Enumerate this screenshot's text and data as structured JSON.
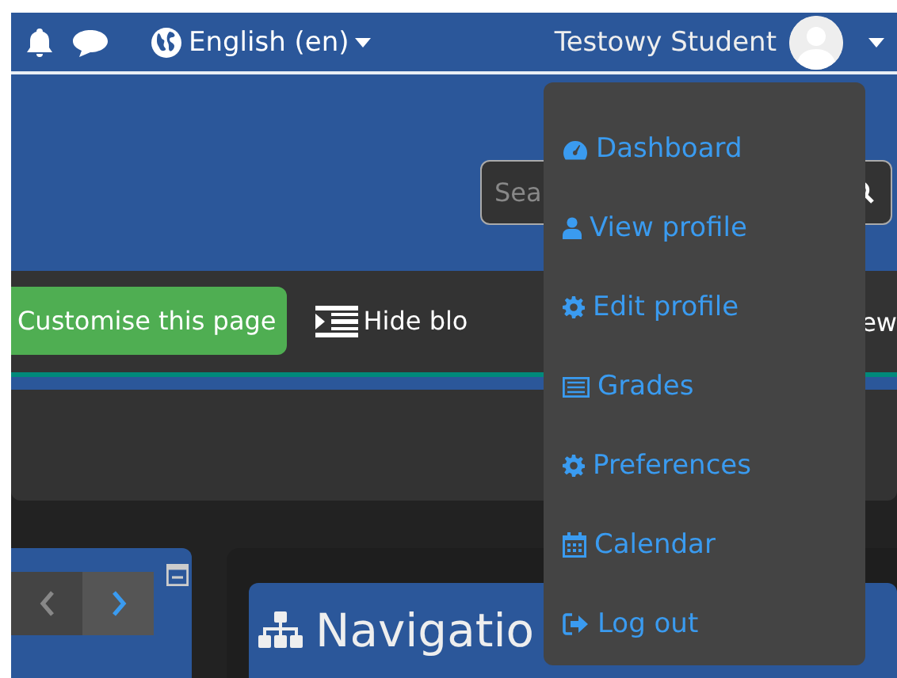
{
  "navbar": {
    "language": "English (en)",
    "user_name": "Testowy Student"
  },
  "header": {
    "search": {
      "placeholder": "Sea"
    }
  },
  "toolbar": {
    "customise_button": "Customise this page",
    "hide_blocks": "Hide blo",
    "view_fragment": "ew"
  },
  "blocks": {
    "navigation_title": "Navigatio"
  },
  "user_menu": {
    "items": [
      {
        "label": "Dashboard",
        "kind": "dashboard"
      },
      {
        "label": "View profile",
        "kind": "user"
      },
      {
        "label": "Edit profile",
        "kind": "gear"
      },
      {
        "label": "Grades",
        "kind": "table"
      },
      {
        "label": "Preferences",
        "kind": "gear"
      },
      {
        "label": "Calendar",
        "kind": "calendar"
      },
      {
        "label": "Log out",
        "kind": "logout"
      }
    ]
  }
}
